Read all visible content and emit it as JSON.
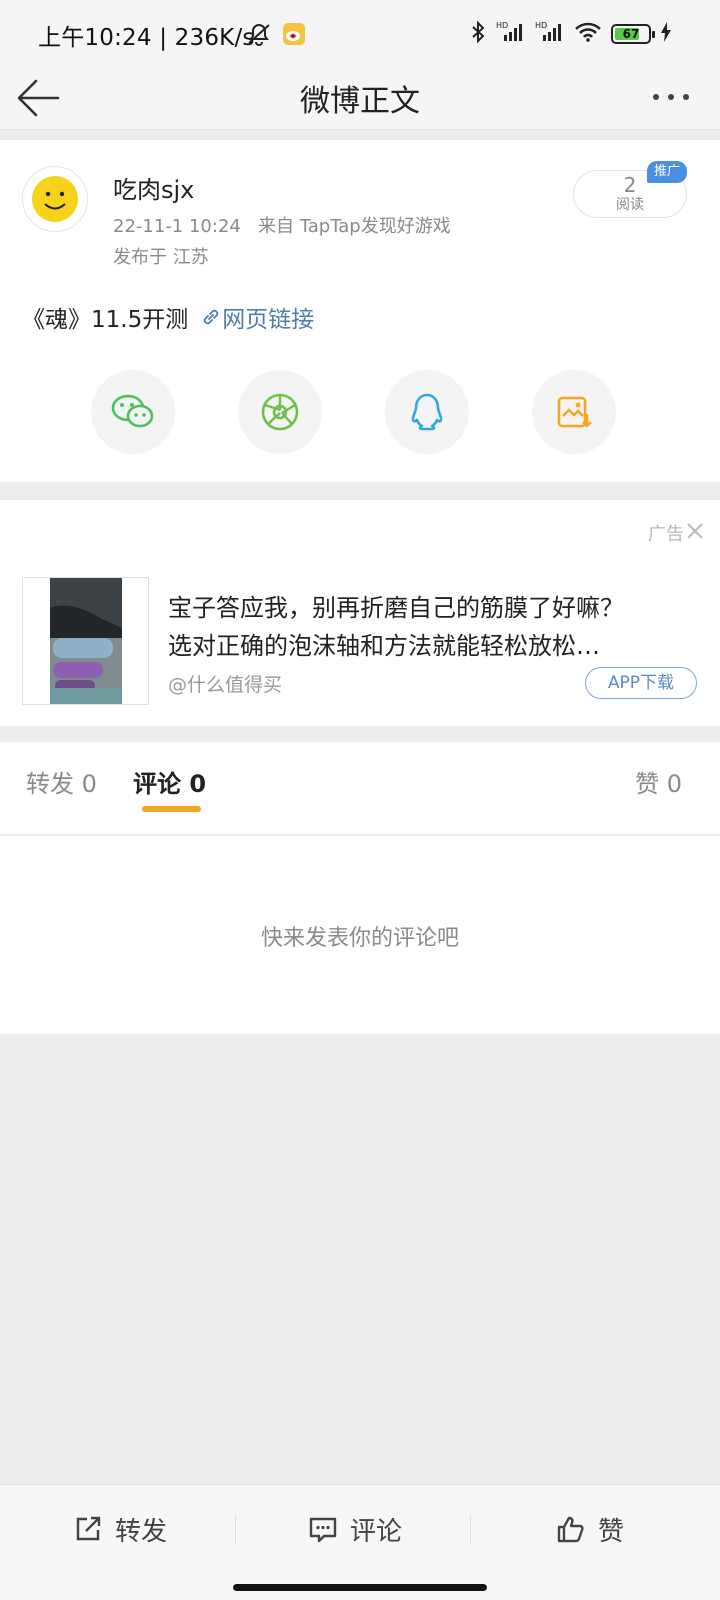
{
  "status_bar": {
    "time": "上午10:24",
    "separator": "|",
    "speed": "236K/s",
    "battery": "67",
    "icons": [
      "bell-off-icon",
      "weibo-app-icon",
      "bluetooth-icon",
      "signal-hd-icon",
      "signal-hd-icon",
      "wifi-icon",
      "battery-icon",
      "charging-icon"
    ]
  },
  "nav": {
    "title": "微博正文",
    "back_icon": "back-arrow-icon",
    "more_icon": "more-icon"
  },
  "post": {
    "username": "吃肉sjx",
    "timestamp": "22-11-1 10:24",
    "source": "来自 TapTap发现好游戏",
    "location": "发布于 江苏",
    "read_count": "2",
    "read_label": "阅读",
    "promo_tag": "推广",
    "text": "《魂》11.5开测",
    "link_text": "网页链接",
    "share_icons": [
      "wechat-icon",
      "moments-icon",
      "qq-icon",
      "save-image-icon"
    ]
  },
  "ad": {
    "label": "广告",
    "line1": "宝子答应我，别再折磨自己的筋膜了好嘛？",
    "line2": "选对正确的泡沫轴和方法就能轻松放松…",
    "source": "@什么值得买",
    "button": "APP下载"
  },
  "tabs": {
    "repost": "转发 0",
    "comment": "评论 0",
    "like": "赞 0"
  },
  "comments": {
    "empty": "快来发表你的评论吧"
  },
  "bottom_bar": {
    "repost": "转发",
    "comment": "评论",
    "like": "赞"
  },
  "colors": {
    "accent_orange": "#f5a623",
    "link_blue": "#507daf",
    "promo_blue": "#4a90e2",
    "wechat_green": "#4cc05a",
    "qq_blue": "#2fa8e0",
    "save_orange": "#f5a623"
  }
}
